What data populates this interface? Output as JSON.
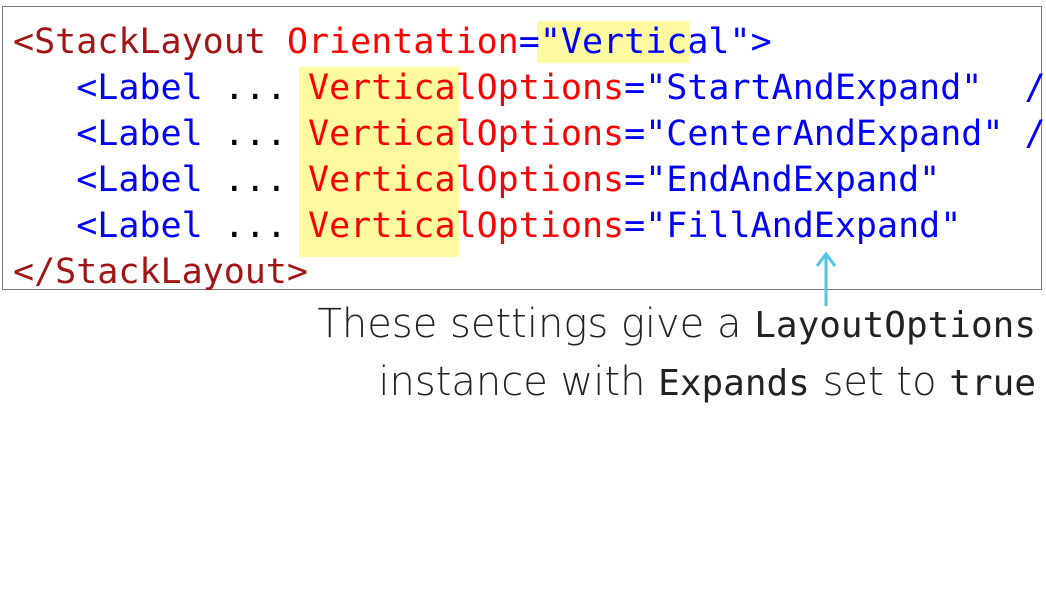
{
  "code": {
    "line1": {
      "open": "<StackLayout",
      "attr": "Orientation",
      "eq": "=",
      "value_q1": "\"",
      "value": "Vertical",
      "value_q2": "\"",
      "close": ">"
    },
    "labels": [
      {
        "open": "<Label",
        "dots": "...",
        "attr_hl": "Vertical",
        "attr_rest": "Options",
        "eq": "=",
        "value": "\"StartAndExpand\"",
        "close": "/>"
      },
      {
        "open": "<Label",
        "dots": "...",
        "attr_hl": "Vertical",
        "attr_rest": "Options",
        "eq": "=",
        "value": "\"CenterAndExpand\"",
        "close": "/>"
      },
      {
        "open": "<Label",
        "dots": "...",
        "attr_hl": "Vertical",
        "attr_rest": "Options",
        "eq": "=",
        "value": "\"EndAndExpand\"",
        "close": "/>"
      },
      {
        "open": "<Label",
        "dots": "...",
        "attr_hl": "Vertical",
        "attr_rest": "Options",
        "eq": "=",
        "value": "\"FillAndExpand\"",
        "close": "/>"
      }
    ],
    "end_tag": "</StackLayout>"
  },
  "note": {
    "part1": "These settings give a ",
    "mono1": "LayoutOptions",
    "part2": "instance with ",
    "mono2": "Expands",
    "part3": " set to ",
    "mono3": "true"
  },
  "colors": {
    "highlight": "#fffa9f",
    "tag": "#a31515",
    "attribute": "#ff0000",
    "value": "#0000ff",
    "arrow": "#4fc3e8"
  }
}
